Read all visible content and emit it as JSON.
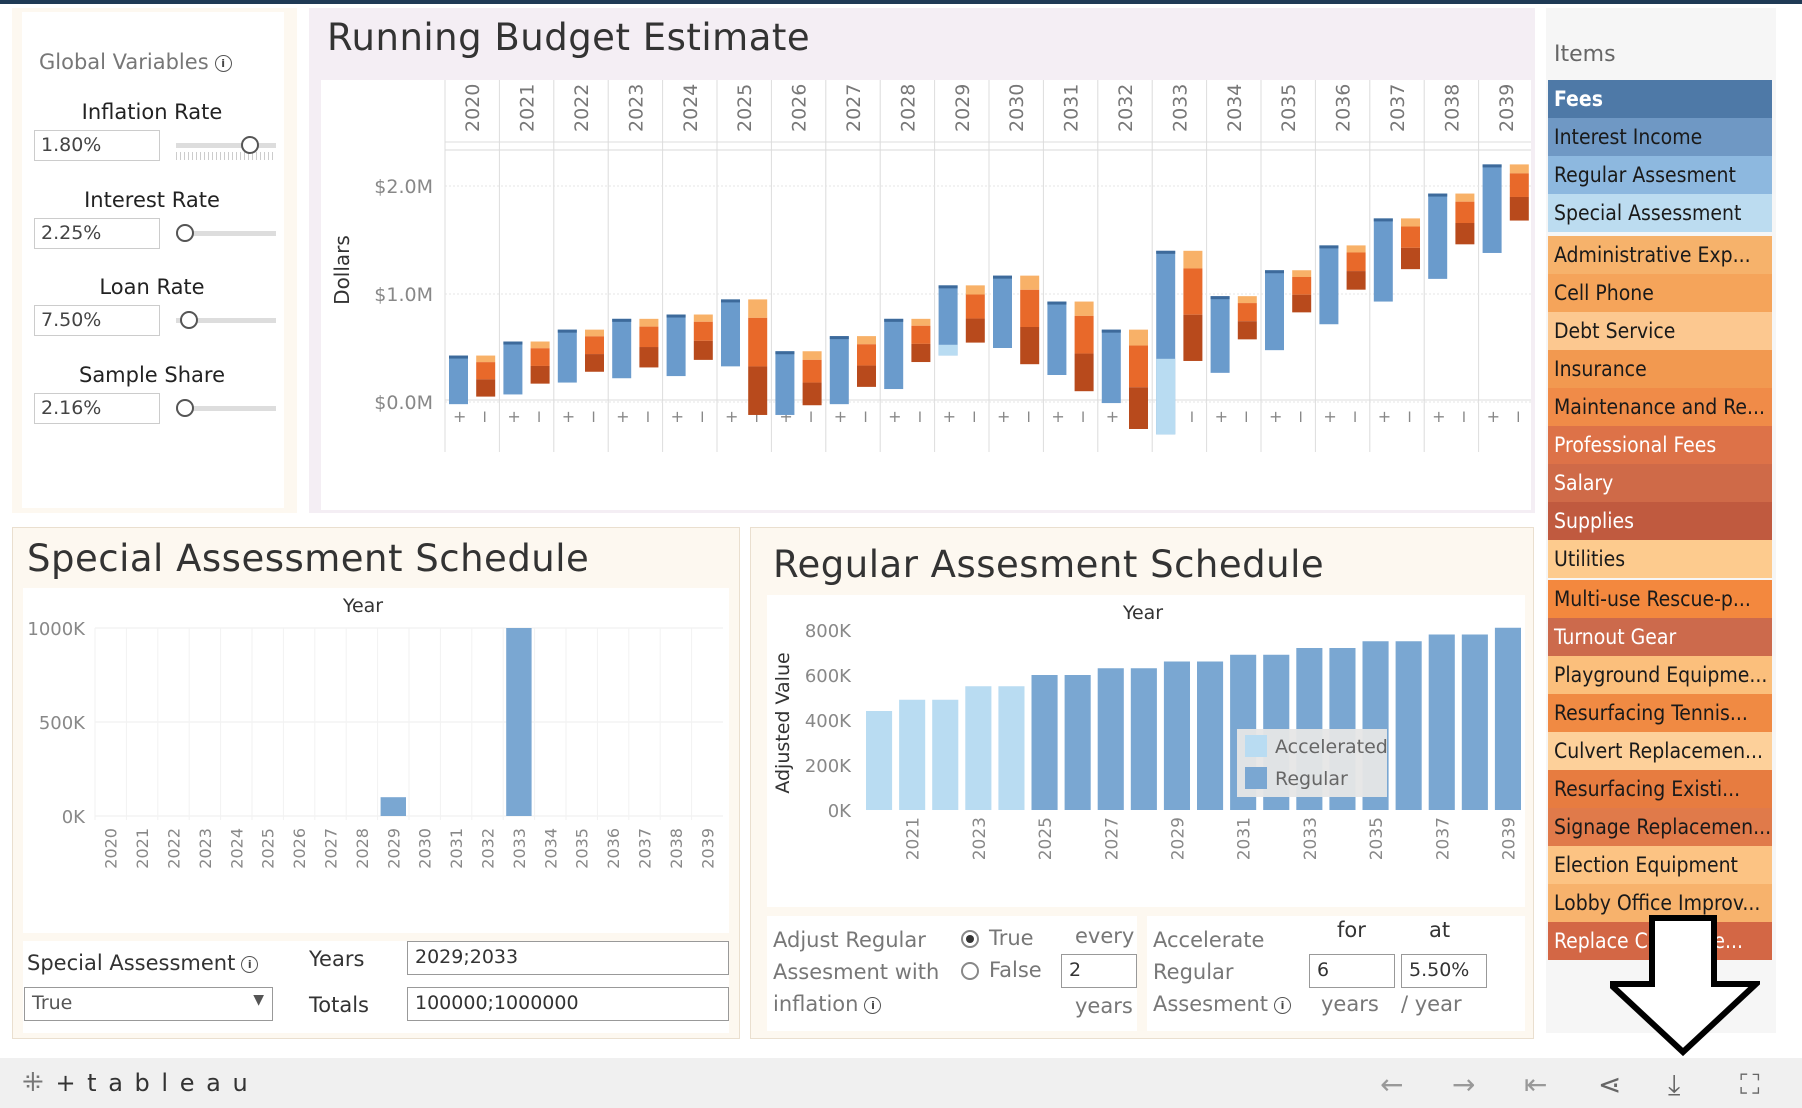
{
  "global_variables": {
    "title": "Global Variables",
    "info_icon": "info-icon",
    "params": [
      {
        "label": "Inflation Rate",
        "value": "1.80%",
        "slider_fraction": 0.75
      },
      {
        "label": "Interest Rate",
        "value": "2.25%",
        "slider_fraction": 0.0
      },
      {
        "label": "Loan Rate",
        "value": "7.50%",
        "slider_fraction": 0.05
      },
      {
        "label": "Sample Share",
        "value": "2.16%",
        "slider_fraction": 0.0
      }
    ]
  },
  "running_budget": {
    "title": "Running Budget Estimate",
    "chart_data": {
      "type": "bar",
      "subtype": "waterfall-paired",
      "x": [
        "2020",
        "2021",
        "2022",
        "2023",
        "2024",
        "2025",
        "2026",
        "2027",
        "2028",
        "2029",
        "2030",
        "2031",
        "2032",
        "2033",
        "2034",
        "2035",
        "2036",
        "2037",
        "2038",
        "2039"
      ],
      "ylabel": "Dollars",
      "yticks": [
        "$0.0M",
        "$1.0M",
        "$2.0M"
      ],
      "ylim": [
        -0.4,
        2.3
      ],
      "column_markers": [
        "+",
        "I"
      ],
      "income": [
        {
          "start": -0.02,
          "end": 0.43
        },
        {
          "start": 0.07,
          "end": 0.56
        },
        {
          "start": 0.18,
          "end": 0.67
        },
        {
          "start": 0.22,
          "end": 0.77
        },
        {
          "start": 0.24,
          "end": 0.81
        },
        {
          "start": 0.33,
          "end": 0.95
        },
        {
          "start": -0.12,
          "end": 0.47
        },
        {
          "start": -0.02,
          "end": 0.61
        },
        {
          "start": 0.12,
          "end": 0.77
        },
        {
          "start": 0.43,
          "end": 1.08,
          "accelerated_part": 0.1
        },
        {
          "start": 0.5,
          "end": 1.17
        },
        {
          "start": 0.25,
          "end": 0.93
        },
        {
          "start": -0.01,
          "end": 0.67
        },
        {
          "start": -0.3,
          "end": 1.4,
          "accelerated_part": 0.7
        },
        {
          "start": 0.27,
          "end": 0.98
        },
        {
          "start": 0.48,
          "end": 1.22
        },
        {
          "start": 0.72,
          "end": 1.45
        },
        {
          "start": 0.93,
          "end": 1.7
        },
        {
          "start": 1.14,
          "end": 1.93
        },
        {
          "start": 1.38,
          "end": 2.2
        }
      ],
      "expenses": [
        {
          "start": 0.43,
          "end": 0.05
        },
        {
          "start": 0.56,
          "end": 0.17
        },
        {
          "start": 0.67,
          "end": 0.28
        },
        {
          "start": 0.77,
          "end": 0.32
        },
        {
          "start": 0.81,
          "end": 0.39
        },
        {
          "start": 0.95,
          "end": -0.12
        },
        {
          "start": 0.47,
          "end": -0.03
        },
        {
          "start": 0.61,
          "end": 0.14
        },
        {
          "start": 0.77,
          "end": 0.37
        },
        {
          "start": 1.08,
          "end": 0.55
        },
        {
          "start": 1.17,
          "end": 0.35
        },
        {
          "start": 0.93,
          "end": 0.1
        },
        {
          "start": 0.67,
          "end": -0.25
        },
        {
          "start": 1.4,
          "end": 0.38
        },
        {
          "start": 0.98,
          "end": 0.58
        },
        {
          "start": 1.22,
          "end": 0.83
        },
        {
          "start": 1.45,
          "end": 1.04
        },
        {
          "start": 1.7,
          "end": 1.23
        },
        {
          "start": 1.93,
          "end": 1.46
        },
        {
          "start": 2.2,
          "end": 1.68
        }
      ]
    }
  },
  "items": {
    "title": "Items",
    "list": [
      {
        "label": "Fees",
        "bg": "#4e79a7",
        "fg": "#ffffff",
        "bold": true
      },
      {
        "label": "Interest Income",
        "bg": "#6f98c4",
        "fg": "#1a1a1a"
      },
      {
        "label": "Regular Assesment",
        "bg": "#8db8df",
        "fg": "#1a1a1a"
      },
      {
        "label": "Special Assessment",
        "bg": "#bcdcf0",
        "fg": "#1a1a1a"
      },
      {
        "label": "Administrative Exp...",
        "bg": "#f6b26b",
        "fg": "#1a1a1a"
      },
      {
        "label": "Cell Phone",
        "bg": "#f5a45a",
        "fg": "#1a1a1a"
      },
      {
        "label": "Debt Service",
        "bg": "#fcc890",
        "fg": "#1a1a1a"
      },
      {
        "label": "Insurance",
        "bg": "#f29950",
        "fg": "#1a1a1a"
      },
      {
        "label": "Maintenance and Re...",
        "bg": "#f08b48",
        "fg": "#1a1a1a"
      },
      {
        "label": "Professional Fees",
        "bg": "#dd7248",
        "fg": "#ffffff"
      },
      {
        "label": "Salary",
        "bg": "#cf6a48",
        "fg": "#ffffff"
      },
      {
        "label": "Supplies",
        "bg": "#c05a3f",
        "fg": "#ffffff"
      },
      {
        "label": "Utilities",
        "bg": "#fdcb8e",
        "fg": "#1a1a1a"
      },
      {
        "label": "Multi-use Rescue-p...",
        "bg": "#f3883e",
        "fg": "#1a1a1a"
      },
      {
        "label": "Turnout Gear",
        "bg": "#cc6a4c",
        "fg": "#ffffff"
      },
      {
        "label": "Playground Equipme...",
        "bg": "#fbbf7c",
        "fg": "#1a1a1a"
      },
      {
        "label": "Resurfacing Tennis...",
        "bg": "#f08a43",
        "fg": "#1a1a1a"
      },
      {
        "label": "Culvert Replacemen...",
        "bg": "#fdd09a",
        "fg": "#1a1a1a"
      },
      {
        "label": "Resurfacing Existi...",
        "bg": "#e77c40",
        "fg": "#1a1a1a"
      },
      {
        "label": "Signage Replacemen...",
        "bg": "#e07a4a",
        "fg": "#1a1a1a"
      },
      {
        "label": "Election Equipment",
        "bg": "#fcc383",
        "fg": "#1a1a1a"
      },
      {
        "label": "Lobby Office Improv...",
        "bg": "#f7b26c",
        "fg": "#1a1a1a"
      },
      {
        "label": "Replace Copier Ve...",
        "bg": "#d36745",
        "fg": "#ffffff"
      }
    ]
  },
  "special_assessment": {
    "title": "Special Assessment Schedule",
    "chart_data": {
      "type": "bar",
      "title": "Year",
      "categories": [
        "2020",
        "2021",
        "2022",
        "2023",
        "2024",
        "2025",
        "2026",
        "2027",
        "2028",
        "2029",
        "2030",
        "2031",
        "2032",
        "2033",
        "2034",
        "2035",
        "2036",
        "2037",
        "2038",
        "2039"
      ],
      "values": [
        0,
        0,
        0,
        0,
        0,
        0,
        0,
        0,
        0,
        100000,
        0,
        0,
        0,
        1000000,
        0,
        0,
        0,
        0,
        0,
        0
      ],
      "yticks": [
        "0K",
        "500K",
        "1000K"
      ],
      "ylim": [
        0,
        1000000
      ]
    },
    "filter_label": "Special Assessment",
    "filter_value": "True",
    "years_label": "Years",
    "years_value": "2029;2033",
    "totals_label": "Totals",
    "totals_value": "100000;1000000"
  },
  "regular_assessment": {
    "title": "Regular Assesment Schedule",
    "chart_data": {
      "type": "bar",
      "title": "Year",
      "ylabel": "Adjusted Value",
      "categories": [
        "2020",
        "2021",
        "2022",
        "2023",
        "2024",
        "2025",
        "2026",
        "2027",
        "2028",
        "2029",
        "2030",
        "2031",
        "2032",
        "2033",
        "2034",
        "2035",
        "2036",
        "2037",
        "2038",
        "2039"
      ],
      "xtick_labels": [
        "2021",
        "2023",
        "2025",
        "2027",
        "2029",
        "2031",
        "2033",
        "2035",
        "2037",
        "2039"
      ],
      "values": [
        440000,
        490000,
        490000,
        550000,
        550000,
        600000,
        600000,
        630000,
        630000,
        660000,
        660000,
        690000,
        690000,
        720000,
        720000,
        750000,
        750000,
        780000,
        780000,
        810000
      ],
      "accelerated": [
        true,
        true,
        true,
        true,
        true,
        false,
        false,
        false,
        false,
        false,
        false,
        false,
        false,
        false,
        false,
        false,
        false,
        false,
        false,
        false
      ],
      "yticks": [
        "0K",
        "200K",
        "400K",
        "600K",
        "800K"
      ],
      "ylim": [
        0,
        800000
      ],
      "legend": [
        "Accelerated",
        "Regular"
      ],
      "legend_colors": [
        "#b9dcf2",
        "#7aa7d2"
      ]
    },
    "adjust_label_1": "Adjust Regular",
    "adjust_label_2": "Assesment with",
    "adjust_label_3": "inflation",
    "radio_true": "True",
    "radio_false": "False",
    "every_label": "every",
    "every_value": "2",
    "years_unit": "years",
    "accelerate_label_1": "Accelerate",
    "accelerate_label_2": "Regular",
    "accelerate_label_3": "Assesment",
    "for_label": "for",
    "for_value": "6",
    "at_label": "at",
    "at_value": "5.50%",
    "per_year": "/ year"
  },
  "footer": {
    "brand": "+ t a b l e a u",
    "icons": [
      "undo-icon",
      "redo-icon",
      "revert-icon",
      "share-icon",
      "download-icon",
      "fullscreen-icon"
    ]
  },
  "colors": {
    "income_dark": "#6a9bcc",
    "income_light": "#b9dcf2",
    "expense_dark": "#b84a1c",
    "expense_mid": "#e8692a",
    "expense_light": "#f8b168",
    "bar_blue": "#7aa7d2",
    "bar_light": "#b9dcf2"
  }
}
